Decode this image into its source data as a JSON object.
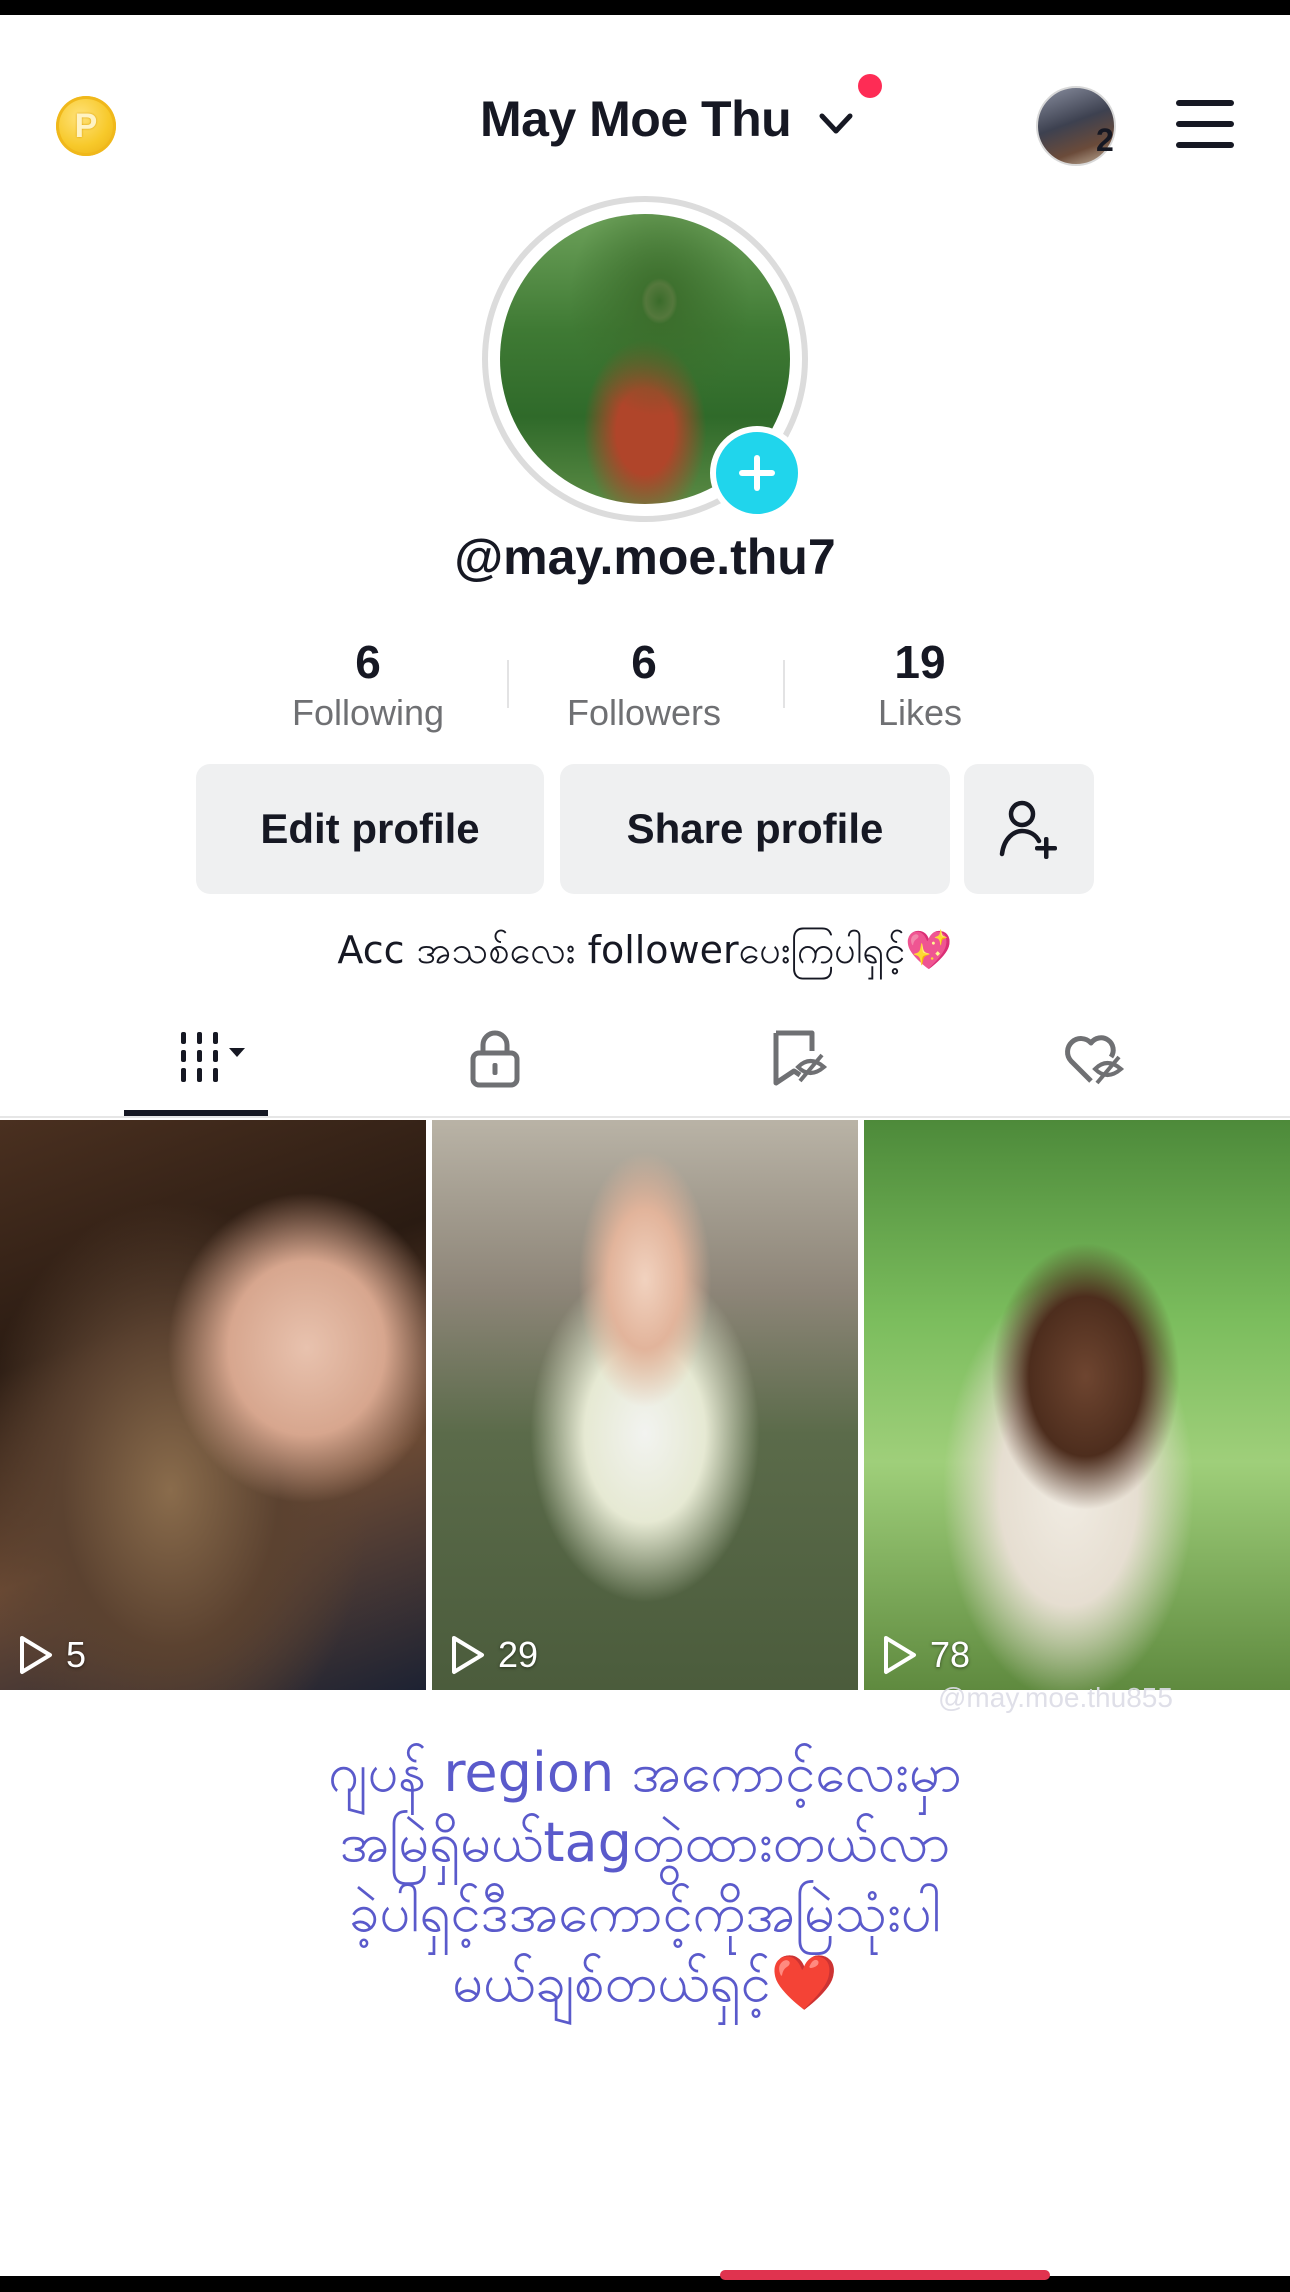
{
  "header": {
    "username_title": "May Moe Thu",
    "friends_count": "2"
  },
  "profile": {
    "handle": "@may.moe.thu7",
    "bio": "Acc အသစ်လေး followerပေးကြပါရှင့်💖"
  },
  "stats": [
    {
      "value": "6",
      "label": "Following"
    },
    {
      "value": "6",
      "label": "Followers"
    },
    {
      "value": "19",
      "label": "Likes"
    }
  ],
  "buttons": {
    "edit_profile": "Edit profile",
    "share_profile": "Share profile"
  },
  "videos": [
    {
      "plays": "5"
    },
    {
      "plays": "29"
    },
    {
      "plays": "78"
    }
  ],
  "watermark": "@may.moe.thu855",
  "overlay_text": {
    "line1": "ဂျပန် region အကောင့်လေးမှာ",
    "line2": "အမြဲရှိမယ်tagတွဲထားတယ်လာ",
    "line3": "ခဲ့ပါရှင့်ဒီအကောင့်ကိုအမြဲသုံးပါ",
    "line4": "မယ်ချစ်တယ်ရှင့်❤️"
  },
  "colors": {
    "accent": "#20d5ec",
    "notification": "#fe2c55",
    "overlay_text": "#5a5acb",
    "button_bg": "#eff0f1"
  },
  "icons": [
    "coin-icon",
    "chevron-down-icon",
    "menu-icon",
    "add-icon",
    "add-friend-icon",
    "grid-icon",
    "lock-icon",
    "bookmark-hidden-icon",
    "heart-hidden-icon",
    "play-icon"
  ]
}
